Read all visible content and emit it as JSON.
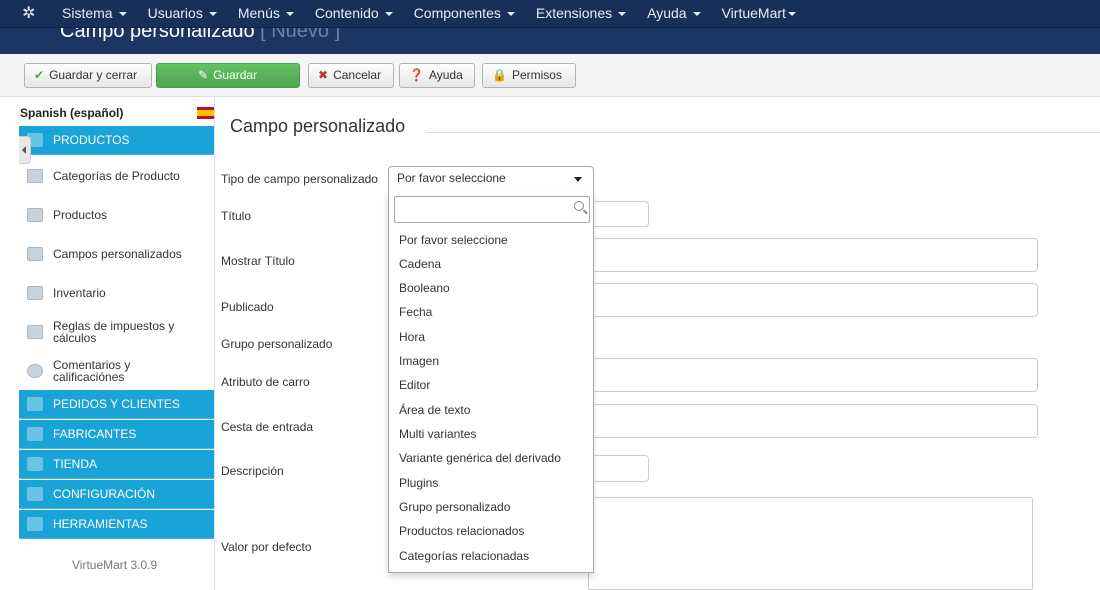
{
  "topnav": {
    "menus": [
      "Sistema",
      "Usuarios",
      "Menús",
      "Contenido",
      "Componentes",
      "Extensiones",
      "Ayuda",
      "VirtueMart"
    ]
  },
  "header": {
    "title": "Campo personalizado",
    "status": "[ Nuevo ]"
  },
  "toolbar": {
    "save_close": "Guardar y cerrar",
    "save": "Guardar",
    "cancel": "Cancelar",
    "help": "Ayuda",
    "permissions": "Permisos"
  },
  "sidebar": {
    "language": "Spanish (español)",
    "sections": {
      "products": "PRODUCTOS",
      "orders": "PEDIDOS Y CLIENTES",
      "manufacturers": "FABRICANTES",
      "shop": "TIENDA",
      "config": "CONFIGURACIÓN",
      "tools": "HERRAMIENTAS"
    },
    "items": {
      "categories": "Categorías de Producto",
      "products": "Productos",
      "custom_fields": "Campos personalizados",
      "inventory": "Inventario",
      "tax": "Reglas de impuestos y cálculos",
      "reviews": "Comentarios y calificaciónes"
    },
    "version": "VirtueMart 3.0.9"
  },
  "form": {
    "legend": "Campo personalizado",
    "labels": {
      "type": "Tipo de campo personalizado",
      "title": "Título",
      "show_title": "Mostrar Título",
      "published": "Publicado",
      "group": "Grupo personalizado",
      "cart_attr": "Atributo de carro",
      "cart_input": "Cesta de entrada",
      "description": "Descripción",
      "default": "Valor por defecto"
    },
    "select_value": "Por favor seleccione",
    "options": [
      "Por favor seleccione",
      "Cadena",
      "Booleano",
      "Fecha",
      "Hora",
      "Imagen",
      "Editor",
      "Área de texto",
      "Multi variantes",
      "Variante genérica del derivado",
      "Plugins",
      "Grupo personalizado",
      "Productos relacionados",
      "Categorías relacionadas"
    ]
  }
}
